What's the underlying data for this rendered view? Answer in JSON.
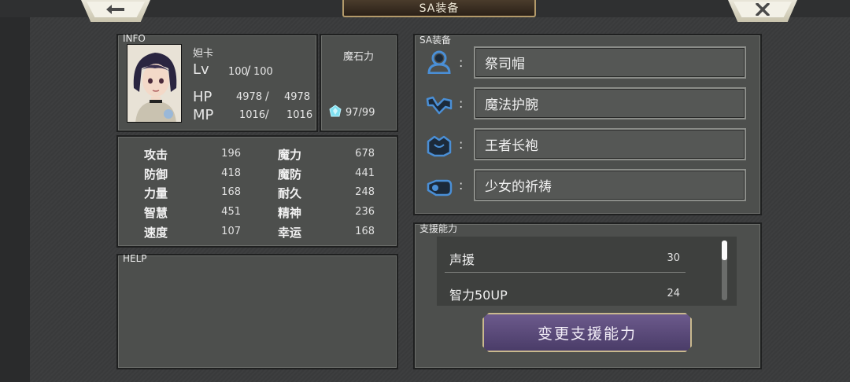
{
  "header": {
    "title": "SA装备",
    "back_icon": "back-arrow-icon",
    "close_icon": "close-icon"
  },
  "info": {
    "section_label": "INFO",
    "name": "妲卡",
    "lv_label": "Lv",
    "lv_current": "100",
    "lv_max": "100",
    "hp_label": "HP",
    "hp_current": "4978",
    "hp_max": "4978",
    "mp_label": "MP",
    "mp_current": "1016",
    "mp_max": "1016",
    "magicite_label": "魔石力",
    "magicite_value": "97/99",
    "magicite_icon": "crystal-icon",
    "magicite_icon_color": "#7fe0f0"
  },
  "stats": [
    {
      "label": "攻击",
      "value": "196"
    },
    {
      "label": "防御",
      "value": "418"
    },
    {
      "label": "力量",
      "value": "168"
    },
    {
      "label": "智慧",
      "value": "451"
    },
    {
      "label": "速度",
      "value": "107"
    },
    {
      "label": "魔力",
      "value": "678"
    },
    {
      "label": "魔防",
      "value": "441"
    },
    {
      "label": "耐久",
      "value": "248"
    },
    {
      "label": "精神",
      "value": "236"
    },
    {
      "label": "幸运",
      "value": "168"
    }
  ],
  "help": {
    "section_label": "HELP"
  },
  "sa_equip": {
    "section_label": "SA装备",
    "slots": [
      {
        "icon": "head-icon",
        "colon": ":",
        "item": "祭司帽"
      },
      {
        "icon": "arm-icon",
        "colon": ":",
        "item": "魔法护腕"
      },
      {
        "icon": "body-icon",
        "colon": ":",
        "item": "王者长袍"
      },
      {
        "icon": "accessory-icon",
        "colon": ":",
        "item": "少女的祈祷"
      }
    ]
  },
  "support": {
    "section_label": "支援能力",
    "items": [
      {
        "name": "声援",
        "cost": "30"
      },
      {
        "name": "智力50UP",
        "cost": "24"
      }
    ],
    "change_button": "变更支援能力"
  },
  "colors": {
    "accent_purple": "#5a4a7a",
    "gold_border": "#c9b98d",
    "icon_blue": "#4a8fd6"
  }
}
